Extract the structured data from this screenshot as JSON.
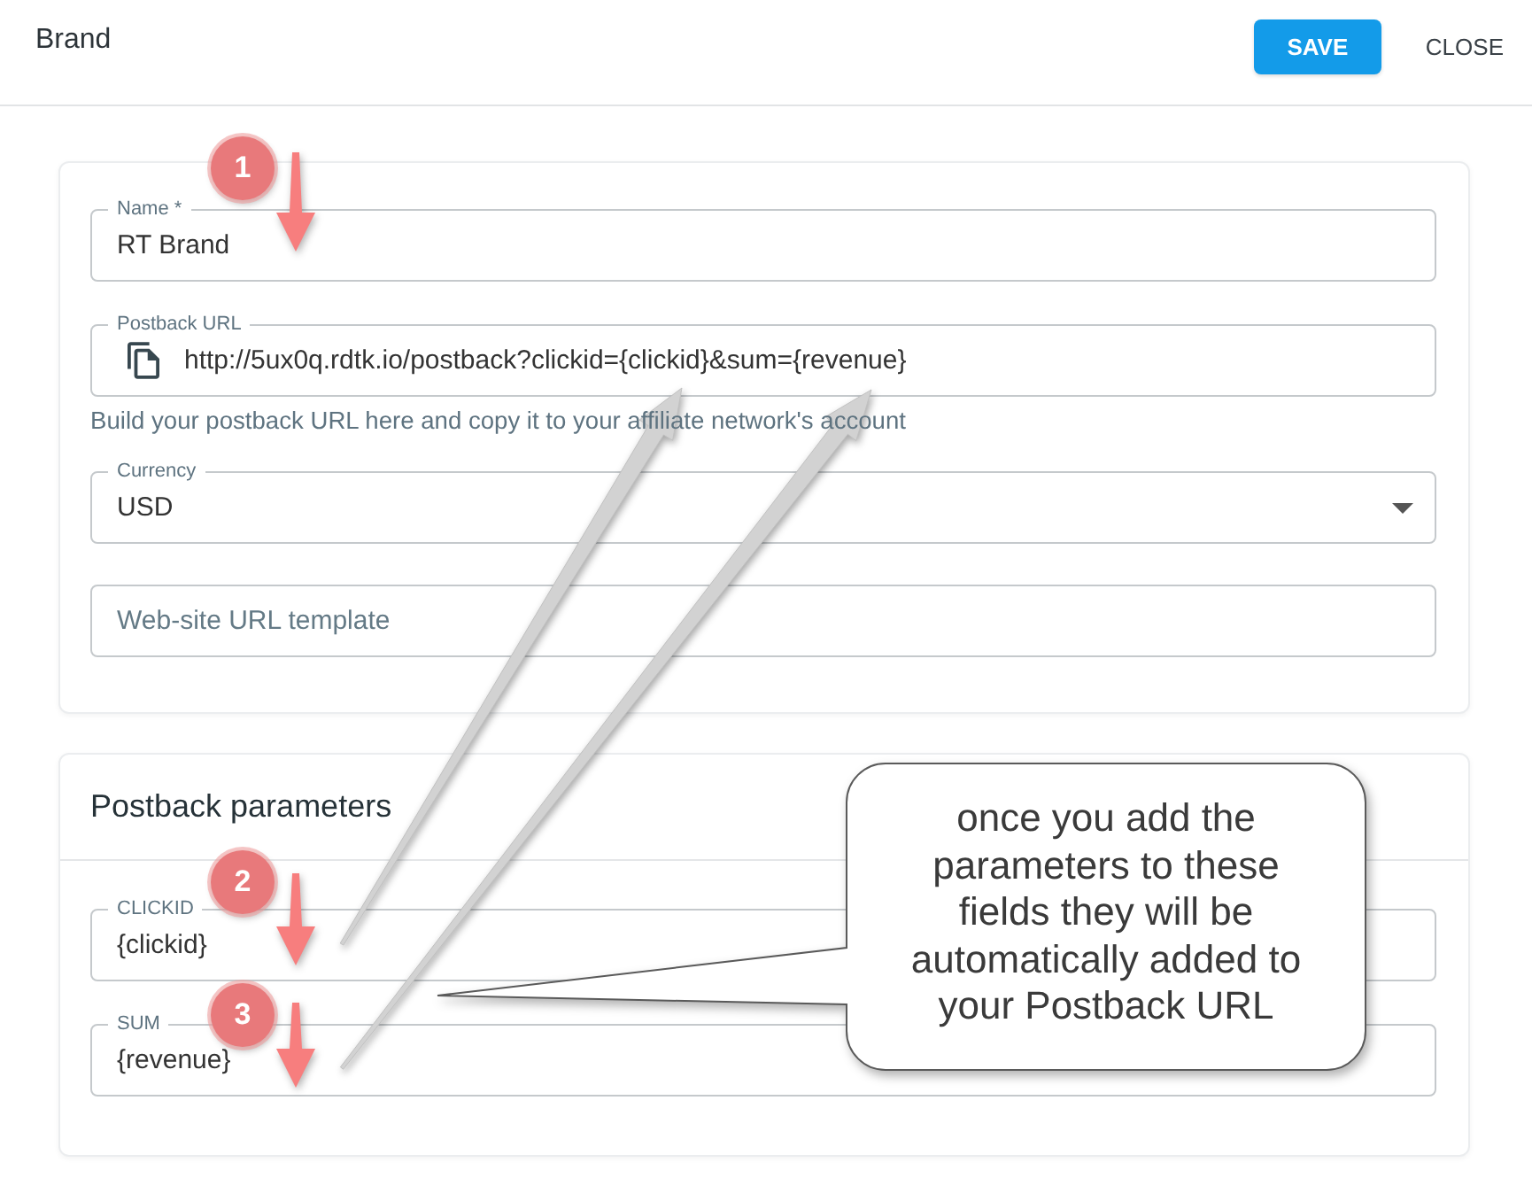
{
  "header": {
    "title": "Brand",
    "buttons": [
      {
        "label": "SAVE",
        "kind": "primary"
      },
      {
        "label": "CLOSE",
        "kind": "text"
      }
    ]
  },
  "brand_form": {
    "fields": [
      {
        "kind": "text",
        "label": "Name *",
        "value": "RT Brand"
      },
      {
        "kind": "copy",
        "label": "Postback URL",
        "value": "http://5ux0q.rdtk.io/postback?clickid={clickid}&sum={revenue}",
        "helper": "Build your postback URL here and copy it to your affiliate network's account"
      },
      {
        "kind": "select",
        "label": "Currency",
        "value": "USD"
      },
      {
        "kind": "text",
        "placeholder": "Web-site URL template"
      }
    ]
  },
  "postback_parameters": {
    "title": "Postback parameters",
    "fields": [
      {
        "kind": "text",
        "label": "CLICKID",
        "value": "{clickid}"
      },
      {
        "kind": "text",
        "label": "SUM",
        "value": "{revenue}"
      }
    ]
  },
  "annotations": {
    "step_markers": [
      {
        "number": "1"
      },
      {
        "number": "2"
      },
      {
        "number": "3"
      }
    ],
    "callout": {
      "text": "once you add the parameters to these fields they will be automatically added to your Postback URL"
    }
  }
}
